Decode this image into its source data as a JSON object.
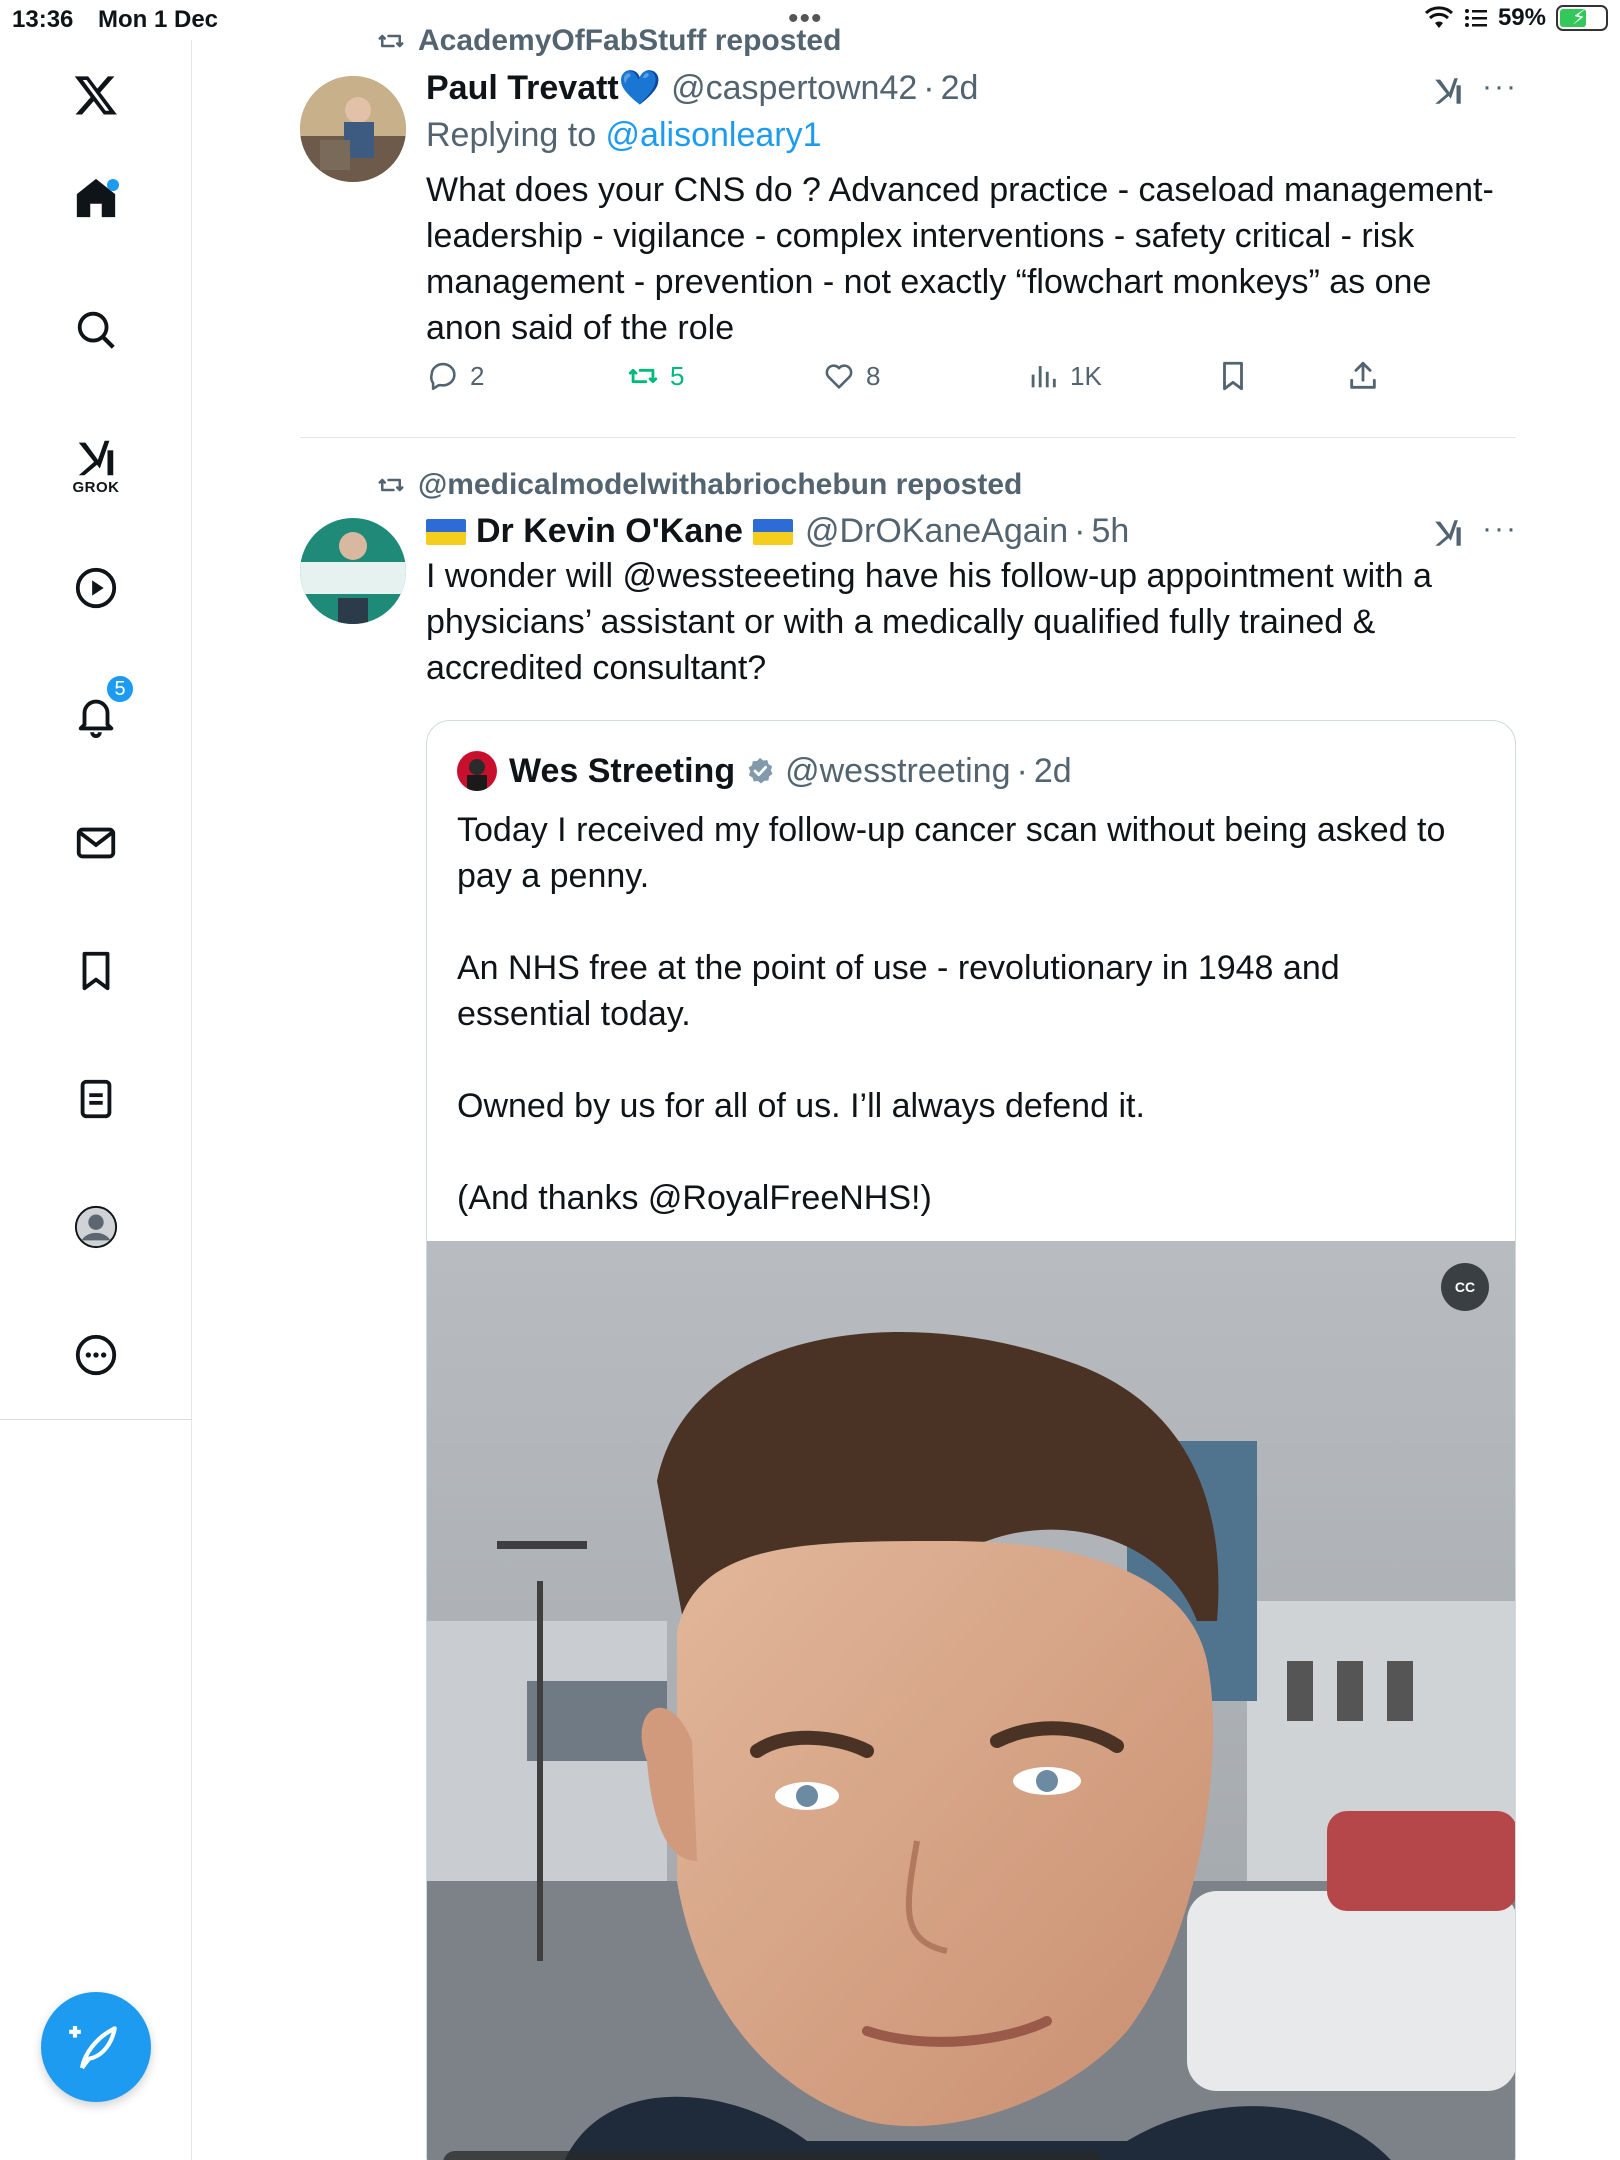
{
  "status_bar": {
    "time": "13:36",
    "date": "Mon 1 Dec",
    "battery": "59%"
  },
  "sidebar": {
    "notifications_count": "5",
    "grok_label": "GROK"
  },
  "tweets": [
    {
      "repost_by": "AcademyOfFabStuff reposted",
      "name": "Paul Trevatt💙",
      "handle": "@caspertown42",
      "time": "2d",
      "reply_prefix": "Replying to ",
      "reply_handle": "@alisonleary1",
      "text": "What does your CNS do ? Advanced practice - caseload management- leadership - vigilance - complex interventions - safety critical - risk management - prevention - not exactly “flowchart monkeys” as one anon said of the role",
      "replies": "2",
      "reposts": "5",
      "likes": "8",
      "views": "1K"
    },
    {
      "repost_by": "@medicalmodelwithabriochebun reposted",
      "name": "Dr Kevin O'Kane",
      "handle": "@DrOKaneAgain",
      "time": "5h",
      "text": "I wonder will @wessteeeting have his follow-up appointment with a physicians’ assistant or with a medically qualified fully trained & accredited consultant?",
      "quote": {
        "name": "Wes Streeting",
        "handle": "@wesstreeting",
        "time": "2d",
        "text": "Today I received my follow-up cancer scan without being asked to pay a penny.\n\nAn NHS free at the point of use - revolutionary in 1948 and essential today.\n\nOwned by us for all of us. I’ll always defend it.\n\n(And thanks @RoyalFreeNHS!)",
        "cc_label": "CC"
      }
    }
  ],
  "colors": {
    "accent": "#1d9bf0",
    "retweet": "#00ba7c",
    "secondary_text": "#536471"
  }
}
